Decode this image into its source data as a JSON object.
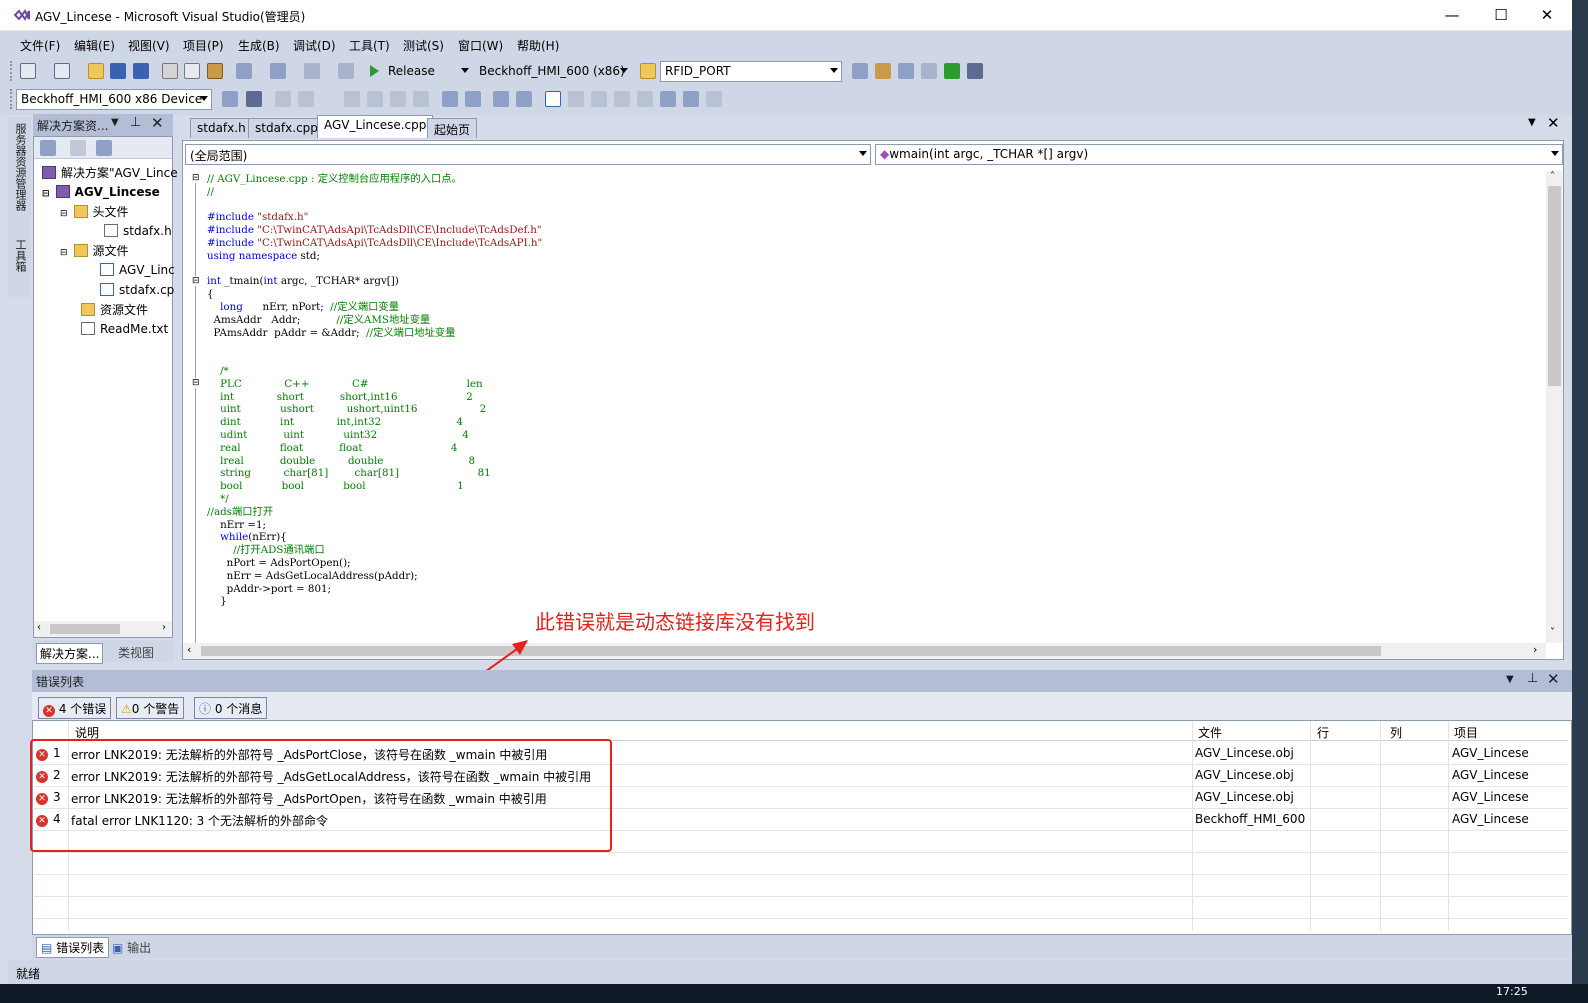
{
  "window": {
    "title": "AGV_Lincese - Microsoft Visual Studio(管理员)",
    "minimize": "—",
    "maximize": "☐",
    "close": "✕"
  },
  "menu": [
    "文件(F)",
    "编辑(E)",
    "视图(V)",
    "项目(P)",
    "生成(B)",
    "调试(D)",
    "工具(T)",
    "测试(S)",
    "窗口(W)",
    "帮助(H)"
  ],
  "toolbar": {
    "config": "Release",
    "platform": "Beckhoff_HMI_600 (x86)",
    "find_target": "RFID_PORT",
    "device": "Beckhoff_HMI_600 x86 Device"
  },
  "side_strip": {
    "server_explorer": "服务器资源管理器",
    "toolbox": "工具箱"
  },
  "solution_explorer": {
    "title": "解决方案资...",
    "items": [
      {
        "label": "解决方案\"AGV_Lince",
        "kind": "solution"
      },
      {
        "label": "AGV_Lincese",
        "kind": "project"
      },
      {
        "label": "头文件",
        "kind": "folder"
      },
      {
        "label": "stdafx.h",
        "kind": "file"
      },
      {
        "label": "源文件",
        "kind": "folder"
      },
      {
        "label": "AGV_Linc",
        "kind": "file"
      },
      {
        "label": "stdafx.cp",
        "kind": "file"
      },
      {
        "label": "资源文件",
        "kind": "folder"
      },
      {
        "label": "ReadMe.txt",
        "kind": "file"
      }
    ],
    "bottom_tabs": [
      "解决方案...",
      "类视图"
    ]
  },
  "editor": {
    "tabs": [
      "stdafx.h",
      "stdafx.cpp",
      "AGV_Lincese.cpp",
      "起始页"
    ],
    "active_tab": "AGV_Lincese.cpp",
    "scope": "(全局范围)",
    "function": "wmain(int argc, _TCHAR *[] argv)",
    "lines": [
      "// AGV_Lincese.cpp : 定义控制台应用程序的入口点。",
      "//",
      "",
      "#include \"stdafx.h\"",
      "#include \"C:\\TwinCAT\\AdsApi\\TcAdsDll\\CE\\Include\\TcAdsDef.h\"",
      "#include \"C:\\TwinCAT\\AdsApi\\TcAdsDll\\CE\\Include\\TcAdsAPI.h\"",
      "using namespace std;",
      "",
      "int _tmain(int argc, _TCHAR* argv[])",
      "{",
      "    long      nErr, nPort;  //定义端口变量",
      "  AmsAddr   Addr;           //定义AMS地址变量",
      "  PAmsAddr  pAddr = &Addr;  //定义端口地址变量",
      "",
      "",
      "    /*",
      "    PLC             C++             C#                              len",
      "",
      "    int             short           short,int16                     2",
      "    uint            ushort          ushort,uint16                   2",
      "    dint            int             int,int32                       4",
      "    udint           uint            uint32                          4",
      "    real            float           float                           4",
      "    lreal           double          double                          8",
      "    string          char[81]        char[81]                        81",
      "    bool            bool            bool                            1",
      "    */",
      "//ads端口打开",
      "    nErr =1;",
      "    while(nErr){",
      "        //打开ADS通讯端口",
      "      nPort = AdsPortOpen();",
      "      nErr = AdsGetLocalAddress(pAddr);",
      "      pAddr->port = 801;",
      "    }"
    ]
  },
  "annotation": "此错误就是动态链接库没有找到",
  "error_list": {
    "title": "错误列表",
    "errors_btn": "4 个错误",
    "warnings_btn": "0 个警告",
    "messages_btn": "0 个消息",
    "columns": [
      "说明",
      "文件",
      "行",
      "列",
      "项目"
    ],
    "rows": [
      {
        "num": "1",
        "desc": "error LNK2019: 无法解析的外部符号 _AdsPortClose，该符号在函数 _wmain 中被引用",
        "file": "AGV_Lincese.obj",
        "project": "AGV_Lincese"
      },
      {
        "num": "2",
        "desc": "error LNK2019: 无法解析的外部符号 _AdsGetLocalAddress，该符号在函数 _wmain 中被引用",
        "file": "AGV_Lincese.obj",
        "project": "AGV_Lincese"
      },
      {
        "num": "3",
        "desc": "error LNK2019: 无法解析的外部符号 _AdsPortOpen，该符号在函数 _wmain 中被引用",
        "file": "AGV_Lincese.obj",
        "project": "AGV_Lincese"
      },
      {
        "num": "4",
        "desc": "fatal error LNK1120: 3 个无法解析的外部命令",
        "file": "Beckhoff_HMI_600",
        "project": "AGV_Lincese"
      }
    ],
    "bottom_tabs": [
      "错误列表",
      "输出"
    ]
  },
  "status": "就绪",
  "clock": "17:25",
  "colors": {
    "error": "#d8342c",
    "annotation": "#e8201a",
    "keyword": "#0000ff",
    "comment": "#008000",
    "string": "#a31515"
  }
}
